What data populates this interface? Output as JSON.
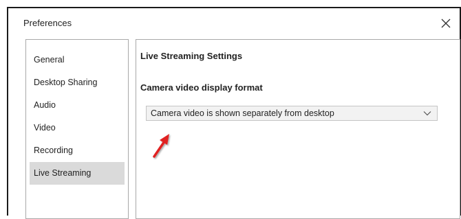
{
  "window": {
    "title": "Preferences",
    "close_icon": "close-icon"
  },
  "sidebar": {
    "items": [
      {
        "label": "General",
        "selected": false
      },
      {
        "label": "Desktop Sharing",
        "selected": false
      },
      {
        "label": "Audio",
        "selected": false
      },
      {
        "label": "Video",
        "selected": false
      },
      {
        "label": "Recording",
        "selected": false
      },
      {
        "label": "Live Streaming",
        "selected": true
      }
    ]
  },
  "main": {
    "heading": "Live Streaming Settings",
    "camera_format": {
      "label": "Camera video display format",
      "selected_value": "Camera video is shown separately from desktop",
      "chevron_icon": "chevron-down-icon"
    }
  },
  "annotation": {
    "icon": "red-arrow-pointer",
    "color": "#e02020"
  }
}
